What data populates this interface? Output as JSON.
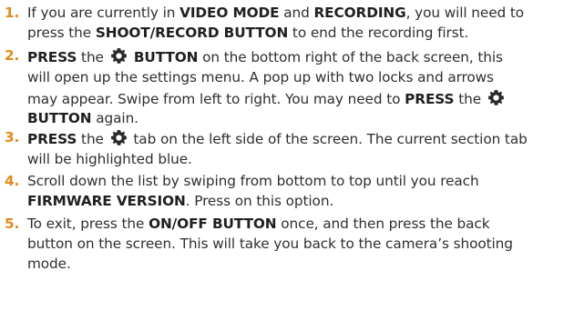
{
  "steps": [
    {
      "number": "1.",
      "lines": [
        [
          "If you are currently in ",
          {
            "b": "VIDEO MODE"
          },
          " and ",
          {
            "b": "RECORDING"
          },
          ", you will need to"
        ],
        [
          "press the ",
          {
            "b": "SHOOT/RECORD BUTTON"
          },
          " to end the recording first."
        ]
      ]
    },
    {
      "number": "2.",
      "lines": [
        [
          {
            "b": "PRESS"
          },
          " the ",
          {
            "icon": "gear"
          },
          {
            "b": " BUTTON"
          },
          " on the bottom right of the back screen, this"
        ],
        [
          "will open up the settings menu. A pop up with two locks and arrows"
        ],
        [
          "may appear. Swipe from left to right. You may need to ",
          {
            "b": "PRESS"
          },
          " the ",
          {
            "icon": "gear"
          }
        ],
        [
          {
            "b": "BUTTON"
          },
          " again."
        ]
      ]
    },
    {
      "number": "3.",
      "lines": [
        [
          {
            "b": "PRESS"
          },
          " the ",
          {
            "icon": "gear"
          },
          " tab on the left side of the screen. The current section tab"
        ],
        [
          "will be highlighted blue."
        ]
      ]
    },
    {
      "number": "4.",
      "lines": [
        [
          "Scroll down the list by swiping from bottom to top until you reach"
        ],
        [
          {
            "b": "FIRMWARE VERSION"
          },
          ". Press on this option."
        ]
      ]
    },
    {
      "number": "5.",
      "lines": [
        [
          "To exit, press the ",
          {
            "b": "ON/OFF BUTTON"
          },
          " once, and then press the back"
        ],
        [
          "button on the screen. This will take you back to the camera’s shooting"
        ],
        [
          "mode."
        ]
      ]
    }
  ],
  "colors": {
    "number": "#e08a1a",
    "text": "#2f2f2f",
    "bold": "#202020"
  },
  "icons": [
    "gear-icon"
  ]
}
